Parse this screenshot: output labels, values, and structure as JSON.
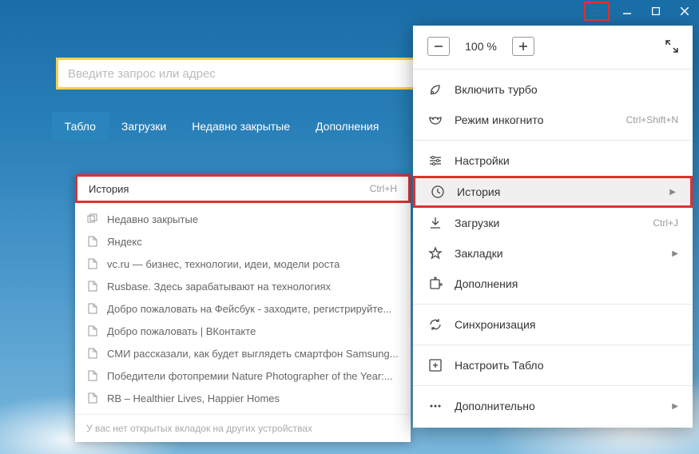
{
  "address": {
    "placeholder": "Введите запрос или адрес"
  },
  "tabs": [
    {
      "label": "Табло",
      "active": true
    },
    {
      "label": "Загрузки",
      "active": false
    },
    {
      "label": "Недавно закрытые",
      "active": false
    },
    {
      "label": "Дополнения",
      "active": false
    }
  ],
  "history_popup": {
    "title": "История",
    "shortcut": "Ctrl+H",
    "items": [
      {
        "icon": "tabs",
        "text": "Недавно закрытые"
      },
      {
        "icon": "page",
        "text": "Яндекс"
      },
      {
        "icon": "page",
        "text": "vc.ru — бизнес, технологии, идеи, модели роста"
      },
      {
        "icon": "page",
        "text": "Rusbase. Здесь зарабатывают на технологиях"
      },
      {
        "icon": "page",
        "text": "Добро пожаловать на Фейсбук - заходите, регистрируйте..."
      },
      {
        "icon": "page",
        "text": "Добро пожаловать | ВКонтакте"
      },
      {
        "icon": "page",
        "text": "СМИ рассказали, как будет выглядеть смартфон Samsung..."
      },
      {
        "icon": "page",
        "text": "Победители фотопремии Nature Photographer of the Year:..."
      },
      {
        "icon": "page",
        "text": "RB – Healthier Lives, Happier Homes"
      }
    ],
    "footer": "У вас нет открытых вкладок на других устройствах"
  },
  "menu": {
    "zoom": {
      "value": "100 %"
    },
    "items": [
      {
        "icon": "rocket",
        "label": "Включить турбо",
        "shortcut": "",
        "arrow": false
      },
      {
        "icon": "mask",
        "label": "Режим инкогнито",
        "shortcut": "Ctrl+Shift+N",
        "arrow": false
      },
      {
        "sep": true
      },
      {
        "icon": "sliders",
        "label": "Настройки",
        "shortcut": "",
        "arrow": false
      },
      {
        "icon": "clock",
        "label": "История",
        "shortcut": "",
        "arrow": true,
        "highlighted": true
      },
      {
        "icon": "download",
        "label": "Загрузки",
        "shortcut": "Ctrl+J",
        "arrow": false
      },
      {
        "icon": "star",
        "label": "Закладки",
        "shortcut": "",
        "arrow": true
      },
      {
        "icon": "puzzle",
        "label": "Дополнения",
        "shortcut": "",
        "arrow": false
      },
      {
        "sep": true
      },
      {
        "icon": "sync",
        "label": "Синхронизация",
        "shortcut": "",
        "arrow": false
      },
      {
        "sep": true
      },
      {
        "icon": "add-tile",
        "label": "Настроить Табло",
        "shortcut": "",
        "arrow": false
      },
      {
        "sep": true
      },
      {
        "icon": "dots",
        "label": "Дополнительно",
        "shortcut": "",
        "arrow": true
      }
    ]
  }
}
